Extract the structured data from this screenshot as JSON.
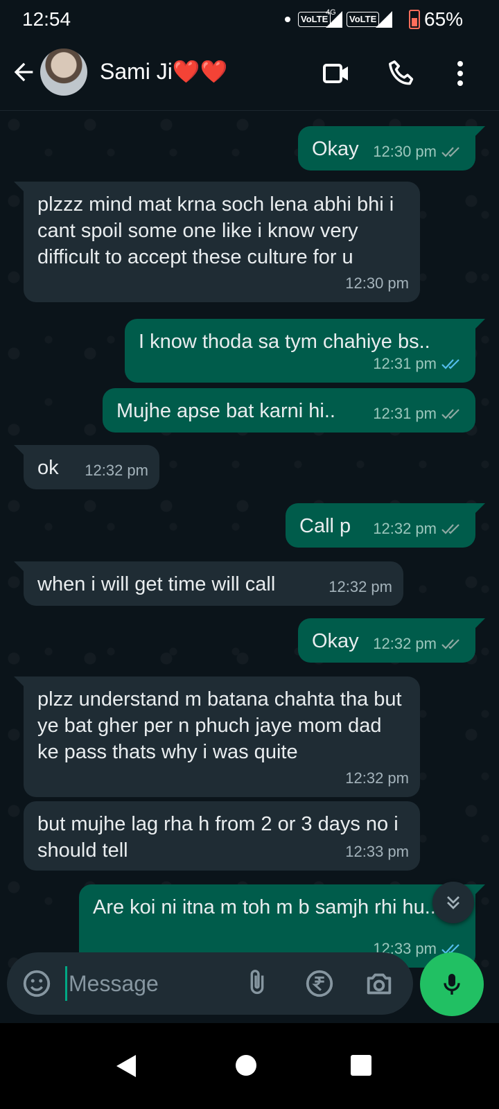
{
  "status_bar": {
    "time": "12:54",
    "network1": "VoLTE",
    "network_type": "4G",
    "network2": "VoLTE",
    "battery": "65%"
  },
  "header": {
    "contact_name": "Sami Ji❤️❤️"
  },
  "messages": [
    {
      "dir": "out",
      "text": "Okay",
      "time": "12:30 pm",
      "read": false
    },
    {
      "dir": "in",
      "text": "plzzz mind mat krna soch lena abhi bhi i cant spoil some one like i know very difficult to accept these culture for u",
      "time": "12:30 pm"
    },
    {
      "dir": "out",
      "text": "I know thoda sa tym chahiye bs..",
      "time": "12:31 pm",
      "read": true
    },
    {
      "dir": "out",
      "text": "Mujhe apse bat karni hi..",
      "time": "12:31 pm",
      "read": false
    },
    {
      "dir": "in",
      "text": "ok",
      "time": "12:32 pm"
    },
    {
      "dir": "out",
      "text": "Call p",
      "time": "12:32 pm",
      "read": false
    },
    {
      "dir": "in",
      "text": "when i will get time will call",
      "time": "12:32 pm"
    },
    {
      "dir": "out",
      "text": "Okay",
      "time": "12:32 pm",
      "read": false
    },
    {
      "dir": "in",
      "text": "plzz understand m batana chahta tha but ye bat gher per n phuch jaye mom dad ke pass thats why i was quite",
      "time": "12:32 pm"
    },
    {
      "dir": "in",
      "text": "but mujhe lag rha h from 2 or 3 days no i should tell",
      "time": "12:33 pm"
    },
    {
      "dir": "out",
      "text": "Are koi ni itna m toh m b samjh rhi hu...",
      "time": "12:33 pm",
      "read": true
    }
  ],
  "composer": {
    "placeholder": "Message"
  },
  "colors": {
    "read_tick": "#53bdeb",
    "delivered_tick": "#8fa9a3",
    "accent": "#21c063"
  },
  "icons": [
    "back-arrow-icon",
    "video-call-icon",
    "voice-call-icon",
    "more-options-icon",
    "sticker-icon",
    "attach-icon",
    "rupee-payment-icon",
    "camera-icon",
    "mic-icon",
    "scroll-down-icon"
  ]
}
